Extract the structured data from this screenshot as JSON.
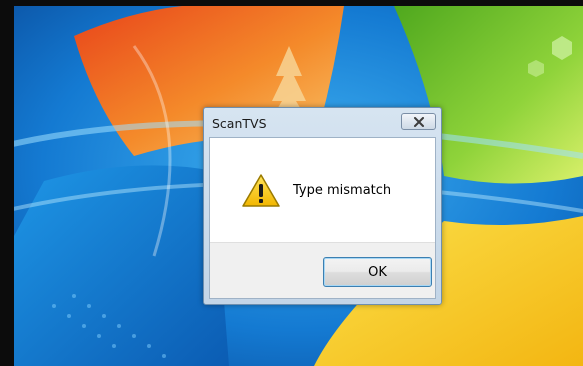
{
  "dialog": {
    "title": "ScanTVS",
    "message": "Type mismatch",
    "ok_label": "OK",
    "icon": "warning-icon",
    "close_icon": "close-icon"
  },
  "colors": {
    "wallpaper_blue": "#1a7fd4",
    "wallpaper_orange": "#f06a1f",
    "wallpaper_green": "#7ec328",
    "wallpaper_yellow": "#f7d21c",
    "warning_yellow": "#f6c400",
    "button_focus_border": "#3c7fb1"
  }
}
